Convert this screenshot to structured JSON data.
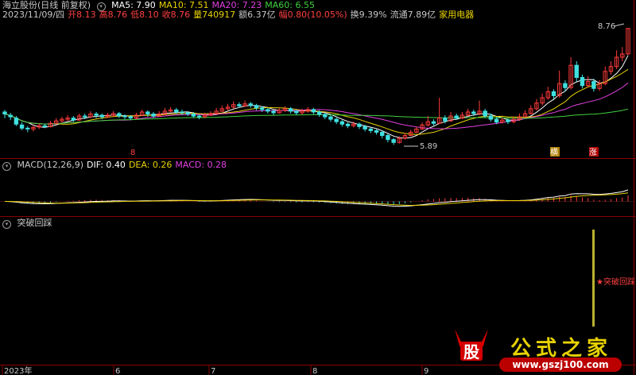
{
  "header": {
    "stock": "海立股份(日线 前复权)",
    "ma_labels": [
      {
        "text": "MA5: 7.90",
        "color": "#ffffff"
      },
      {
        "text": "MA10: 7.51",
        "color": "#e8d200"
      },
      {
        "text": "MA20: 7.23",
        "color": "#e040e0"
      },
      {
        "text": "MA60: 6.55",
        "color": "#40d040"
      }
    ],
    "info": [
      {
        "text": "2023/11/09/四",
        "color": "#c8c8c8"
      },
      {
        "text": "开8.13",
        "color": "#ff4040"
      },
      {
        "text": "高8.76",
        "color": "#ff4040"
      },
      {
        "text": "低8.10",
        "color": "#ff4040"
      },
      {
        "text": "收8.76",
        "color": "#ff4040"
      },
      {
        "text": "量740917",
        "color": "#e8d200"
      },
      {
        "text": "额6.37亿",
        "color": "#c8c8c8"
      },
      {
        "text": "幅0.80(10.05%)",
        "color": "#ff4040"
      },
      {
        "text": "换9.39%",
        "color": "#c8c8c8"
      },
      {
        "text": "流通7.89亿",
        "color": "#c8c8c8"
      },
      {
        "text": "家用电器",
        "color": "#e8d200"
      }
    ]
  },
  "macd_header": [
    {
      "text": "MACD(12,26,9)",
      "color": "#c8c8c8"
    },
    {
      "text": "DIF: 0.40",
      "color": "#ffffff"
    },
    {
      "text": "DEA: 0.26",
      "color": "#e8d200"
    },
    {
      "text": "MACD: 0.28",
      "color": "#e040e0"
    }
  ],
  "indicator_header": "突破回踩",
  "price_labels": {
    "high": "8.76",
    "low": "5.89"
  },
  "markers": {
    "left_marker": "8",
    "marker_a": "横",
    "marker_b": "涨"
  },
  "indicator_signal": "突破回踩",
  "x_ticks": [
    {
      "label": "2023年",
      "pos": 0.0
    },
    {
      "label": "6",
      "pos": 0.175
    },
    {
      "label": "7",
      "pos": 0.325
    },
    {
      "label": "8",
      "pos": 0.485
    },
    {
      "label": "9",
      "pos": 0.66
    }
  ],
  "watermark": {
    "gu": "股",
    "title": "公式之家",
    "url": "www.gszj100.com"
  },
  "colors": {
    "up": "#ff3b3b",
    "down": "#40e0e0",
    "ma5": "#ffffff",
    "ma10": "#e8d200",
    "ma20": "#e040e0",
    "ma60": "#40d040",
    "panel_border": "#8b0000",
    "signal_bar": "#b8b030"
  },
  "chart_data": {
    "type": "candlestick",
    "y_range": [
      5.7,
      8.95
    ],
    "candles": [
      [
        6.7,
        6.65,
        6.75,
        6.55
      ],
      [
        6.62,
        6.58,
        6.68,
        6.5
      ],
      [
        6.55,
        6.4,
        6.6,
        6.35
      ],
      [
        6.38,
        6.3,
        6.45,
        6.25
      ],
      [
        6.3,
        6.28,
        6.35,
        6.2
      ],
      [
        6.28,
        6.32,
        6.38,
        6.22
      ],
      [
        6.33,
        6.36,
        6.42,
        6.28
      ],
      [
        6.36,
        6.34,
        6.4,
        6.3
      ],
      [
        6.34,
        6.42,
        6.48,
        6.32
      ],
      [
        6.42,
        6.48,
        6.55,
        6.4
      ],
      [
        6.48,
        6.52,
        6.58,
        6.44
      ],
      [
        6.52,
        6.55,
        6.62,
        6.48
      ],
      [
        6.55,
        6.5,
        6.6,
        6.45
      ],
      [
        6.5,
        6.6,
        6.66,
        6.48
      ],
      [
        6.6,
        6.58,
        6.66,
        6.52
      ],
      [
        6.58,
        6.65,
        6.72,
        6.55
      ],
      [
        6.65,
        6.62,
        6.7,
        6.55
      ],
      [
        6.62,
        6.58,
        6.66,
        6.52
      ],
      [
        6.58,
        6.62,
        6.68,
        6.55
      ],
      [
        6.62,
        6.66,
        6.72,
        6.58
      ],
      [
        6.66,
        6.6,
        6.7,
        6.55
      ],
      [
        6.6,
        6.58,
        6.64,
        6.52
      ],
      [
        6.58,
        6.55,
        6.62,
        6.5
      ],
      [
        6.55,
        6.62,
        6.68,
        6.52
      ],
      [
        6.62,
        6.7,
        6.76,
        6.6
      ],
      [
        6.7,
        6.65,
        6.74,
        6.58
      ],
      [
        6.65,
        6.6,
        6.7,
        6.55
      ],
      [
        6.6,
        6.65,
        6.72,
        6.58
      ],
      [
        6.65,
        6.72,
        6.8,
        6.62
      ],
      [
        6.72,
        6.75,
        6.82,
        6.68
      ],
      [
        6.75,
        6.7,
        6.8,
        6.65
      ],
      [
        6.7,
        6.68,
        6.76,
        6.62
      ],
      [
        6.68,
        6.65,
        6.72,
        6.6
      ],
      [
        6.65,
        6.6,
        6.7,
        6.55
      ],
      [
        6.6,
        6.58,
        6.64,
        6.52
      ],
      [
        6.58,
        6.62,
        6.68,
        6.55
      ],
      [
        6.62,
        6.66,
        6.72,
        6.6
      ],
      [
        6.66,
        6.72,
        6.8,
        6.64
      ],
      [
        6.72,
        6.78,
        6.86,
        6.7
      ],
      [
        6.78,
        6.82,
        6.9,
        6.74
      ],
      [
        6.82,
        6.88,
        6.96,
        6.78
      ],
      [
        6.88,
        6.85,
        6.94,
        6.8
      ],
      [
        6.85,
        6.9,
        6.98,
        6.82
      ],
      [
        6.9,
        6.86,
        6.95,
        6.8
      ],
      [
        6.86,
        6.8,
        6.9,
        6.74
      ],
      [
        6.8,
        6.76,
        6.84,
        6.7
      ],
      [
        6.76,
        6.72,
        6.8,
        6.66
      ],
      [
        6.72,
        6.68,
        6.76,
        6.62
      ],
      [
        6.68,
        6.74,
        6.8,
        6.66
      ],
      [
        6.74,
        6.78,
        6.84,
        6.7
      ],
      [
        6.78,
        6.72,
        6.82,
        6.66
      ],
      [
        6.72,
        6.68,
        6.76,
        6.62
      ],
      [
        6.68,
        6.72,
        6.78,
        6.64
      ],
      [
        6.72,
        6.76,
        6.82,
        6.68
      ],
      [
        6.76,
        6.7,
        6.8,
        6.64
      ],
      [
        6.7,
        6.64,
        6.74,
        6.58
      ],
      [
        6.64,
        6.58,
        6.68,
        6.52
      ],
      [
        6.58,
        6.52,
        6.62,
        6.46
      ],
      [
        6.52,
        6.46,
        6.56,
        6.4
      ],
      [
        6.46,
        6.4,
        6.5,
        6.34
      ],
      [
        6.4,
        6.36,
        6.44,
        6.3
      ],
      [
        6.36,
        6.4,
        6.46,
        6.32
      ],
      [
        6.4,
        6.34,
        6.44,
        6.28
      ],
      [
        6.34,
        6.28,
        6.38,
        6.22
      ],
      [
        6.28,
        6.24,
        6.32,
        6.18
      ],
      [
        6.24,
        6.2,
        6.28,
        6.14
      ],
      [
        6.2,
        6.12,
        6.24,
        6.05
      ],
      [
        6.12,
        6.02,
        6.16,
        5.95
      ],
      [
        6.02,
        5.95,
        6.06,
        5.89
      ],
      [
        5.95,
        6.05,
        6.1,
        5.92
      ],
      [
        6.05,
        6.12,
        6.18,
        6.02
      ],
      [
        6.12,
        6.2,
        6.26,
        6.1
      ],
      [
        6.2,
        6.28,
        6.34,
        6.18
      ],
      [
        6.28,
        6.38,
        6.44,
        6.26
      ],
      [
        6.38,
        6.46,
        6.6,
        6.34
      ],
      [
        6.46,
        6.42,
        6.52,
        6.36
      ],
      [
        6.42,
        6.55,
        7.05,
        6.4
      ],
      [
        6.55,
        6.48,
        6.62,
        6.42
      ],
      [
        6.48,
        6.6,
        6.7,
        6.46
      ],
      [
        6.6,
        6.55,
        6.66,
        6.5
      ],
      [
        6.55,
        6.62,
        6.7,
        6.52
      ],
      [
        6.62,
        6.7,
        6.78,
        6.6
      ],
      [
        6.7,
        6.66,
        6.76,
        6.6
      ],
      [
        6.66,
        6.72,
        6.98,
        6.62
      ],
      [
        6.72,
        6.6,
        6.78,
        6.55
      ],
      [
        6.6,
        6.52,
        6.66,
        6.46
      ],
      [
        6.52,
        6.45,
        6.58,
        6.4
      ],
      [
        6.45,
        6.5,
        6.56,
        6.42
      ],
      [
        6.5,
        6.46,
        6.54,
        6.4
      ],
      [
        6.46,
        6.52,
        6.58,
        6.42
      ],
      [
        6.52,
        6.58,
        6.66,
        6.48
      ],
      [
        6.58,
        6.66,
        6.74,
        6.56
      ],
      [
        6.66,
        6.78,
        6.86,
        6.64
      ],
      [
        6.78,
        6.92,
        7.02,
        6.74
      ],
      [
        6.92,
        7.05,
        7.15,
        6.86
      ],
      [
        7.05,
        7.2,
        7.32,
        7.0
      ],
      [
        7.2,
        7.1,
        7.26,
        7.02
      ],
      [
        7.1,
        7.4,
        7.72,
        7.05
      ],
      [
        7.4,
        7.3,
        7.48,
        7.2
      ],
      [
        7.3,
        7.85,
        8.05,
        7.26
      ],
      [
        7.85,
        7.55,
        7.95,
        7.45
      ],
      [
        7.55,
        7.35,
        7.62,
        7.28
      ],
      [
        7.35,
        7.45,
        7.58,
        7.3
      ],
      [
        7.45,
        7.28,
        7.52,
        7.2
      ],
      [
        7.28,
        7.4,
        7.48,
        7.22
      ],
      [
        7.4,
        7.7,
        7.82,
        7.36
      ],
      [
        7.7,
        7.82,
        7.95,
        7.62
      ],
      [
        7.82,
        8.05,
        8.22,
        7.76
      ],
      [
        8.05,
        8.13,
        8.3,
        7.95
      ],
      [
        8.13,
        8.76,
        8.76,
        8.1
      ]
    ]
  }
}
